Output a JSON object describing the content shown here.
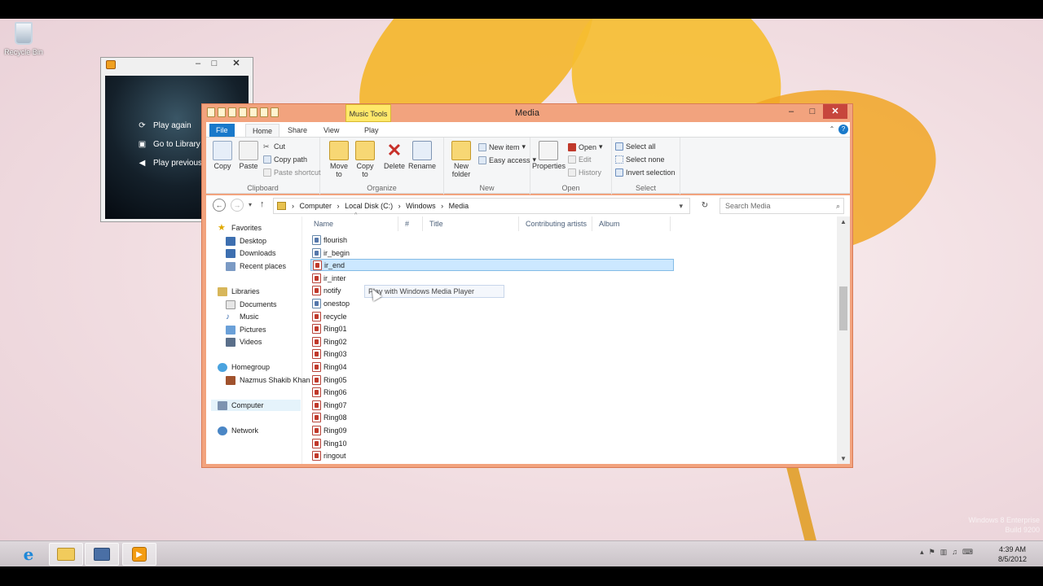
{
  "desktop": {
    "recycle_bin_label": "Recycle Bin",
    "watermark_line1": "Windows 8 Enterprise",
    "watermark_line2": "Build 9200"
  },
  "wmp_window": {
    "options": [
      {
        "label": "Play again",
        "icon": "play-again-icon"
      },
      {
        "label": "Go to Library",
        "icon": "go-to-library-icon"
      },
      {
        "label": "Play previous",
        "icon": "play-previous-icon"
      }
    ]
  },
  "explorer": {
    "title": "Media",
    "music_tools_label": "Music Tools",
    "tabs": {
      "file": "File",
      "home": "Home",
      "share": "Share",
      "view": "View",
      "play": "Play"
    },
    "ribbon": {
      "clipboard": {
        "label": "Clipboard",
        "copy": "Copy",
        "paste": "Paste",
        "cut": "Cut",
        "copy_path": "Copy path",
        "paste_shortcut": "Paste shortcut"
      },
      "organize": {
        "label": "Organize",
        "move_to": "Move to",
        "copy_to": "Copy to",
        "delete": "Delete",
        "rename": "Rename"
      },
      "new": {
        "label": "New",
        "new_folder": "New folder",
        "new_item": "New item",
        "easy_access": "Easy access"
      },
      "open": {
        "label": "Open",
        "properties": "Properties",
        "open": "Open",
        "edit": "Edit",
        "history": "History"
      },
      "select": {
        "label": "Select",
        "select_all": "Select all",
        "select_none": "Select none",
        "invert_selection": "Invert selection"
      }
    },
    "breadcrumb": [
      "Computer",
      "Local Disk (C:)",
      "Windows",
      "Media"
    ],
    "search_placeholder": "Search Media",
    "nav": {
      "favorites": "Favorites",
      "desktop": "Desktop",
      "downloads": "Downloads",
      "recent_places": "Recent places",
      "libraries": "Libraries",
      "documents": "Documents",
      "music": "Music",
      "pictures": "Pictures",
      "videos": "Videos",
      "homegroup": "Homegroup",
      "user": "Nazmus Shakib Khan",
      "computer": "Computer",
      "network": "Network"
    },
    "columns": {
      "name": "Name",
      "number": "#",
      "title": "Title",
      "artists": "Contributing artists",
      "album": "Album"
    },
    "files": [
      "flourish",
      "ir_begin",
      "ir_end",
      "ir_inter",
      "notify",
      "onestop",
      "recycle",
      "Ring01",
      "Ring02",
      "Ring03",
      "Ring04",
      "Ring05",
      "Ring06",
      "Ring07",
      "Ring08",
      "Ring09",
      "Ring10",
      "ringout"
    ],
    "selected_file": "ir_end",
    "tooltip": "Play with Windows Media Player"
  },
  "taskbar": {
    "time": "4:39 AM",
    "date": "8/5/2012"
  },
  "colors": {
    "accent": "#1979ca",
    "window_border": "#f2a37e",
    "close": "#c7463c",
    "selection": "#cce8ff"
  }
}
